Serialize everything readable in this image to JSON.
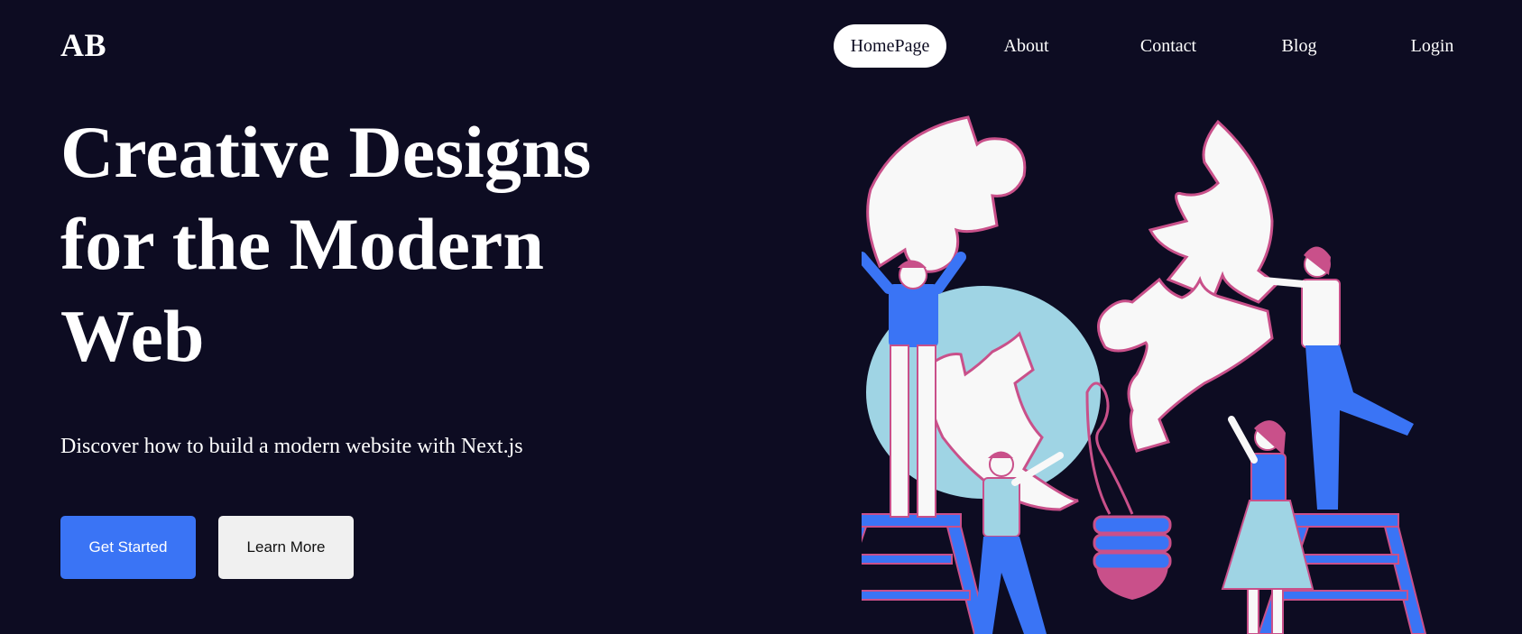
{
  "logo": "AB",
  "nav": {
    "items": [
      {
        "label": "HomePage",
        "active": true
      },
      {
        "label": "About"
      },
      {
        "label": "Contact"
      },
      {
        "label": "Blog"
      },
      {
        "label": "Login"
      }
    ]
  },
  "hero": {
    "title_line1": "Creative Designs",
    "title_line2": "for the Modern",
    "title_line3": "Web",
    "subtitle": "Discover how to build a modern website with Next.js",
    "primary_button": "Get Started",
    "secondary_button": "Learn More"
  },
  "illustration": {
    "name": "team-assembling-puzzle-illustration"
  },
  "colors": {
    "background": "#0d0c22",
    "accent": "#3a74f5",
    "puzzle_outline": "#c9508a",
    "circle": "#9fd4e4",
    "pink_shape": "#c9508a",
    "button_secondary_bg": "#f0f0f0"
  }
}
